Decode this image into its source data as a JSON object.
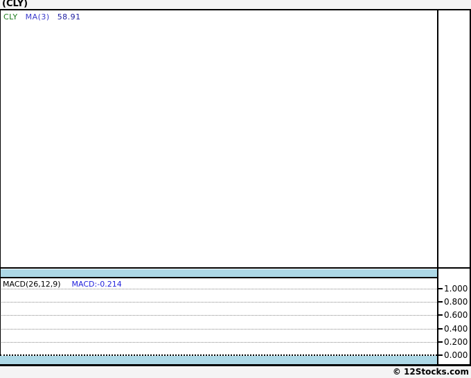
{
  "header": {
    "title": "(CLY)"
  },
  "main_chart": {
    "legend": {
      "symbol": "CLY",
      "indicator": "MA(3)",
      "value": "58.91"
    },
    "colors": {
      "symbol": "#1a7a1a",
      "indicator": "#3a3acc",
      "value": "#1a1aa0"
    }
  },
  "macd_panel": {
    "label": "MACD(26,12,9)",
    "value": "MACD:-0.214",
    "value_color": "#2222dd",
    "yticks": [
      "1.000",
      "0.800",
      "0.600",
      "0.400",
      "0.200",
      "0.000"
    ]
  },
  "footer": {
    "credit": "© 12Stocks.com"
  },
  "colors": {
    "band": "#add8e6",
    "background": "#f4f4f4",
    "border": "#000000",
    "grid": "#888888"
  },
  "chart_data": [
    {
      "type": "line",
      "title": "(CLY)",
      "series": [
        {
          "name": "CLY",
          "values": []
        },
        {
          "name": "MA(3)",
          "last_value": 58.91,
          "values": []
        }
      ],
      "legend_position": "top-left",
      "note": "price panel plot area is rendered empty (no visible data points)"
    },
    {
      "type": "line",
      "title": "MACD(26,12,9)",
      "series": [
        {
          "name": "MACD",
          "last_value": -0.214,
          "values": []
        }
      ],
      "ylim": [
        0.0,
        1.0
      ],
      "yticks": [
        1.0,
        0.8,
        0.6,
        0.4,
        0.2,
        0.0
      ],
      "grid": "horizontal dotted",
      "legend_position": "top-left",
      "note": "indicator panel rendered empty; MACD value -0.214 lies below visible axis range"
    }
  ]
}
